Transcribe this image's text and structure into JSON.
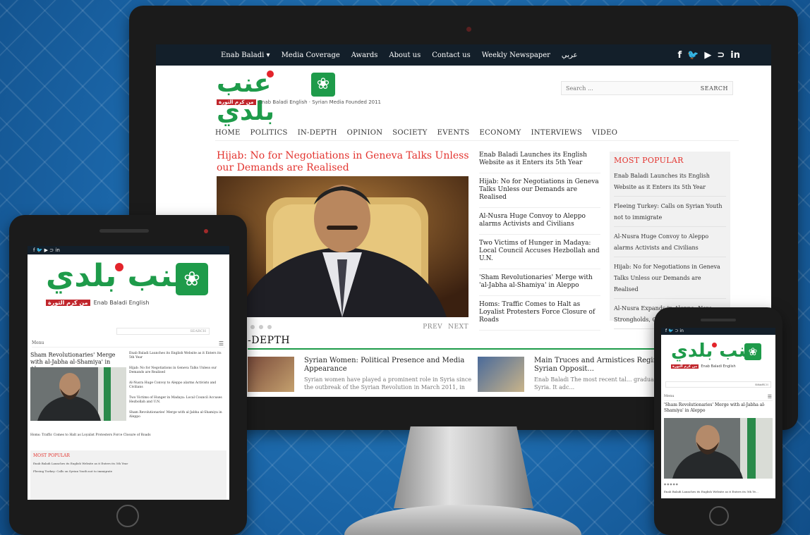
{
  "desktop": {
    "topnav": [
      "Enab Baladi ▾",
      "Media Coverage",
      "Awards",
      "About us",
      "Contact us",
      "Weekly Newspaper",
      "عربي"
    ],
    "social": [
      "f",
      "🐦",
      "▶",
      "⊃",
      "in"
    ],
    "logo": {
      "arabic": "عنب بلدي",
      "badge": "❀",
      "subtitle_ar": "من كرم الثورة",
      "subtitle_en": "Enab Baladi English",
      "tagline": "Syrian Media Founded 2011"
    },
    "search": {
      "placeholder": "Search ...",
      "button": "SEARCH"
    },
    "mainnav": [
      "HOME",
      "POLITICS",
      "IN-DEPTH",
      "OPINION",
      "SOCIETY",
      "EVENTS",
      "ECONOMY",
      "INTERVIEWS",
      "VIDEO"
    ],
    "feature_title": "Hijab: No for Negotiations in Geneva Talks Unless our Demands are Realised",
    "slider": {
      "prev": "PREV",
      "next": "NEXT"
    },
    "headlines": [
      "Enab Baladi Launches its English Website as it Enters its 5th Year",
      "Hijab: No for Negotiations in Geneva Talks Unless our Demands are Realised",
      "Al-Nusra Huge Convoy to Aleppo alarms Activists and Civilians",
      "Two Victims of Hunger in Madaya: Local Council Accuses Hezbollah and U.N.",
      "'Sham Revolutionaries' Merge with 'al-Jabha al-Shamiya' in Aleppo",
      "Homs: Traffic Comes to Halt as Loyalist Protesters Force Closure of Roads"
    ],
    "popular": {
      "title": "MOST POPULAR",
      "items": [
        "Enab Baladi Launches its English Website as it Enters its 5th Year",
        "Fleeing Turkey: Calls on Syrian Youth not to immigrate",
        "Al-Nusra Huge Convoy to Aleppo alarms Activists and Civilians",
        "Hijab: No for Negotiations in Geneva Talks Unless our Demands are Realised",
        "Al-Nusra Expands in Aleppo: New Strongholds, C..."
      ]
    },
    "section_heading": "-DEPTH",
    "articles": [
      {
        "title": "Syrian Women: Political Presence and Media Appearance",
        "desc": "Syrian women have played a prominent role in Syria since the outbreak of the Syrian Revolution in March 2011, in"
      },
      {
        "title": "Main Truces and Armistices Regime and Syrian Opposit...",
        "desc": "Enab Baladi The most recent tal... gradual ceasefire in Syria. It adc..."
      }
    ]
  },
  "tablet": {
    "search_button": "SEARCH",
    "menu": "Menu",
    "feature_title": "Sham Revolutionaries' Merge with al-Jabha al-Shamiya' in Aleppo",
    "headlines": [
      "Enab Baladi Launches its English Website as it Enters its 5th Year",
      "Hijab: No for Negotiations in Geneva Talks Unless our Demands are Realised",
      "Al-Nusra Huge Convoy to Aleppo alarms Activists and Civilians",
      "Two Victims of Hunger in Madaya: Local Council Accuses Hezbollah and U.N.",
      "Sham Revolutionaries' Merge with al-Jabha al-Shamiya in Aleppo"
    ],
    "footer_headline": "Homs: Traffic Comes to Halt as Loyalist Protesters Force Closure of Roads",
    "popular": {
      "title": "MOST POPULAR",
      "items": [
        "Enab Baladi Launches its English Website as it Enters its 5th Year",
        "Fleeing Turkey: Calls on Syrian Youth not to immigrate"
      ]
    }
  },
  "phone": {
    "search_placeholder": "Search ...",
    "search_button": "SEARCH",
    "menu": "Menu",
    "feature_title": "'Sham Revolutionaries' Merge with al-Jabha al-Shamiya' in Aleppo",
    "footer_headline": "Enab Baladi Launches its English Website as it Enters its 5th Ye..."
  }
}
